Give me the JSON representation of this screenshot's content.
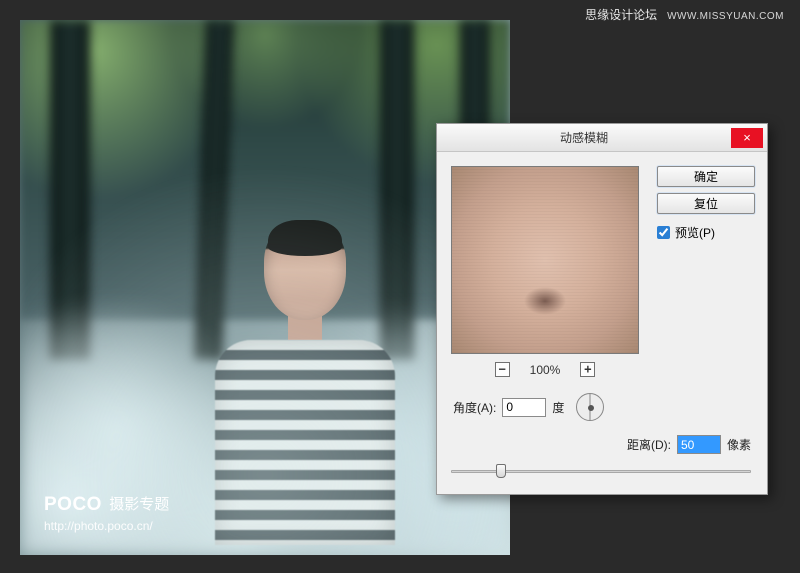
{
  "watermark_top": {
    "forum": "思缘设计论坛",
    "url": "WWW.MISSYUAN.COM"
  },
  "watermark_poco": {
    "logo_main": "POCO",
    "sub": "摄影专题",
    "url": "http://photo.poco.cn/"
  },
  "dialog": {
    "title": "动感模糊",
    "close_glyph": "×",
    "buttons": {
      "ok": "确定",
      "reset": "复位"
    },
    "preview_checkbox": {
      "label": "预览(P)",
      "checked": true
    },
    "zoom": {
      "minus": "−",
      "plus": "+",
      "value": "100%"
    },
    "angle": {
      "label": "角度(A):",
      "value": "0",
      "unit": "度"
    },
    "distance": {
      "label": "距离(D):",
      "value": "50",
      "unit": "像素"
    }
  }
}
